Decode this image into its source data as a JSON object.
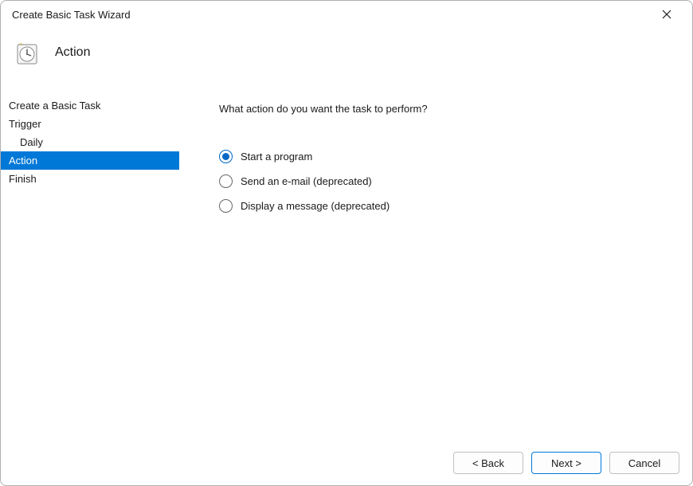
{
  "window": {
    "title": "Create Basic Task Wizard"
  },
  "header": {
    "title": "Action"
  },
  "sidebar": {
    "items": [
      {
        "label": "Create a Basic Task",
        "sub": false,
        "active": false
      },
      {
        "label": "Trigger",
        "sub": false,
        "active": false
      },
      {
        "label": "Daily",
        "sub": true,
        "active": false
      },
      {
        "label": "Action",
        "sub": false,
        "active": true
      },
      {
        "label": "Finish",
        "sub": false,
        "active": false
      }
    ]
  },
  "main": {
    "question": "What action do you want the task to perform?",
    "options": [
      {
        "label": "Start a program",
        "checked": true
      },
      {
        "label": "Send an e-mail (deprecated)",
        "checked": false
      },
      {
        "label": "Display a message (deprecated)",
        "checked": false
      }
    ]
  },
  "footer": {
    "back": "< Back",
    "next": "Next >",
    "cancel": "Cancel"
  }
}
